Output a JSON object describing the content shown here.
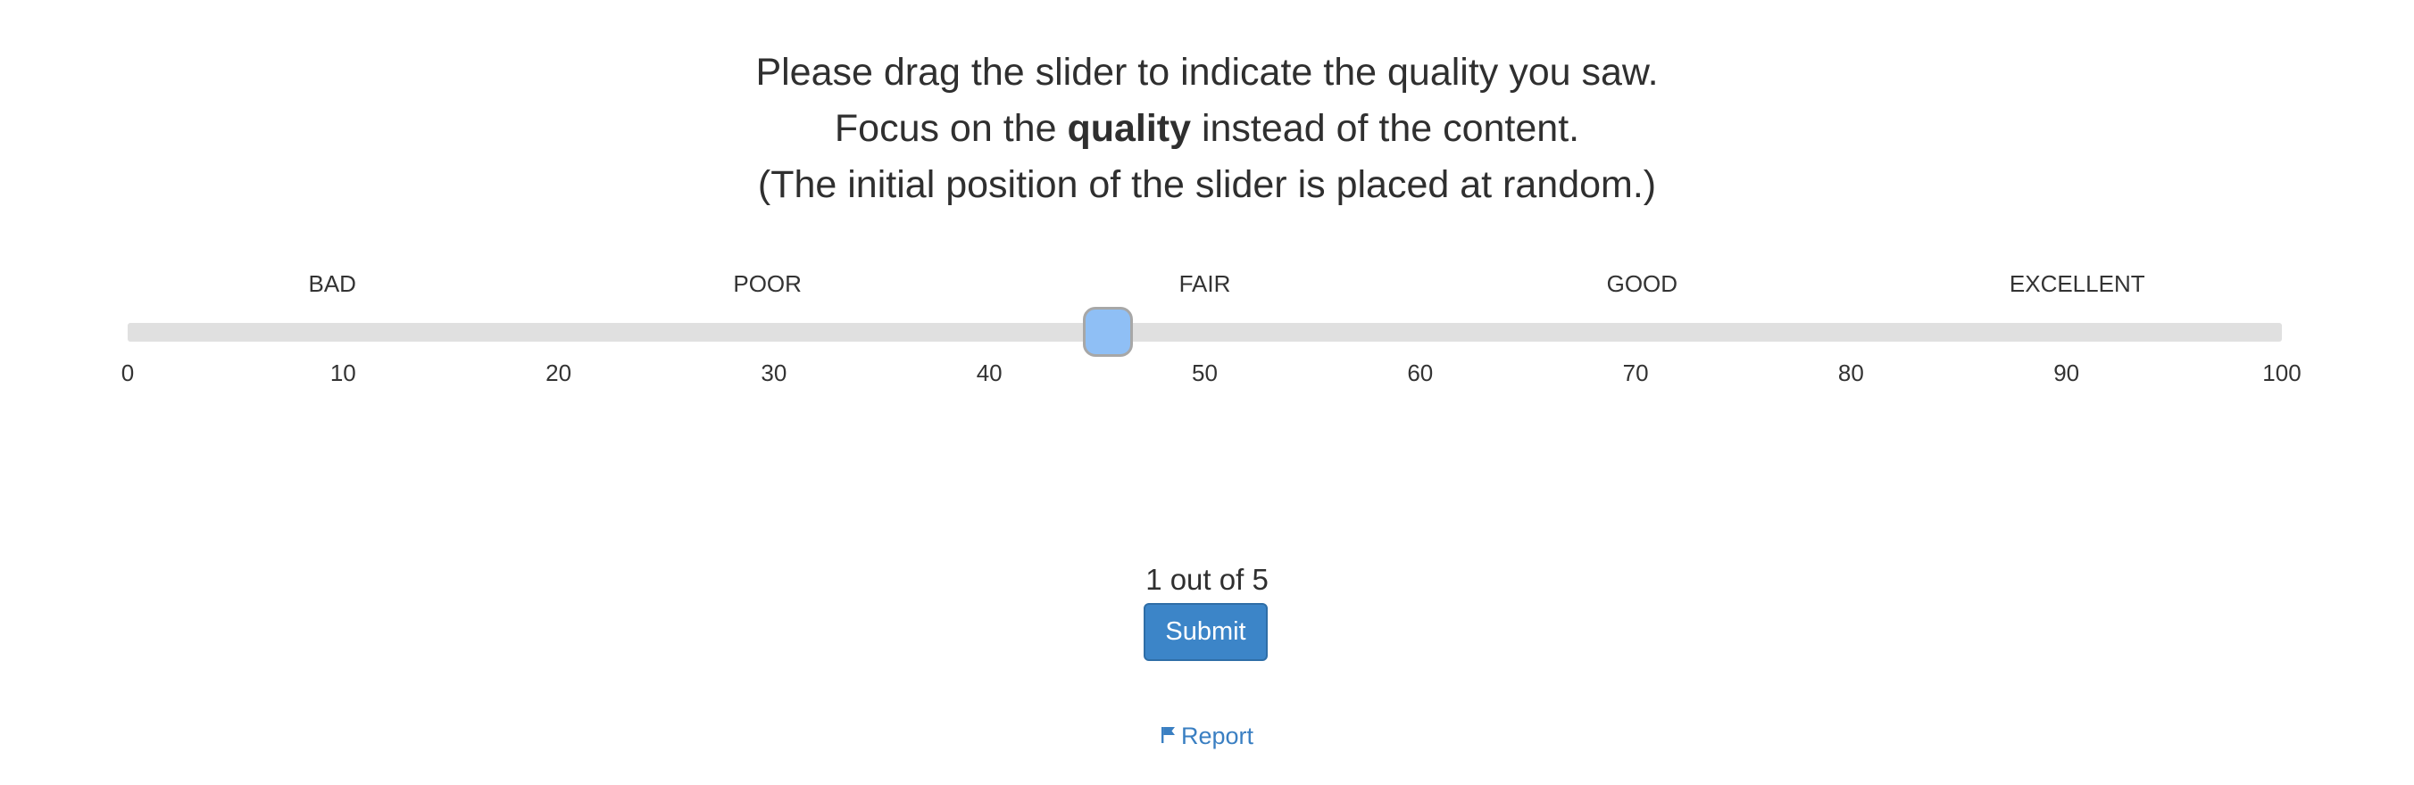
{
  "instructions": {
    "line1": "Please drag the slider to indicate the quality you saw.",
    "line2_prefix": "Focus on the ",
    "line2_bold": "quality",
    "line2_suffix": " instead of the content.",
    "line3": "(The initial position of the slider is placed at random.)"
  },
  "slider": {
    "min": 0,
    "max": 100,
    "value": 45.5,
    "categories": [
      {
        "label": "BAD",
        "value": 9.5
      },
      {
        "label": "POOR",
        "value": 29.7
      },
      {
        "label": "FAIR",
        "value": 50
      },
      {
        "label": "GOOD",
        "value": 70.3
      },
      {
        "label": "EXCELLENT",
        "value": 90.5
      }
    ],
    "ticks": [
      "0",
      "10",
      "20",
      "30",
      "40",
      "50",
      "60",
      "70",
      "80",
      "90",
      "100"
    ]
  },
  "progress": {
    "text": "1 out of 5"
  },
  "submit": {
    "label": "Submit"
  },
  "report": {
    "label": "Report",
    "icon": "flag-icon"
  },
  "colors": {
    "thumb": "#8fbff5",
    "track": "#e0e0e0",
    "button": "#3c85c8",
    "link": "#3a7fc2"
  }
}
